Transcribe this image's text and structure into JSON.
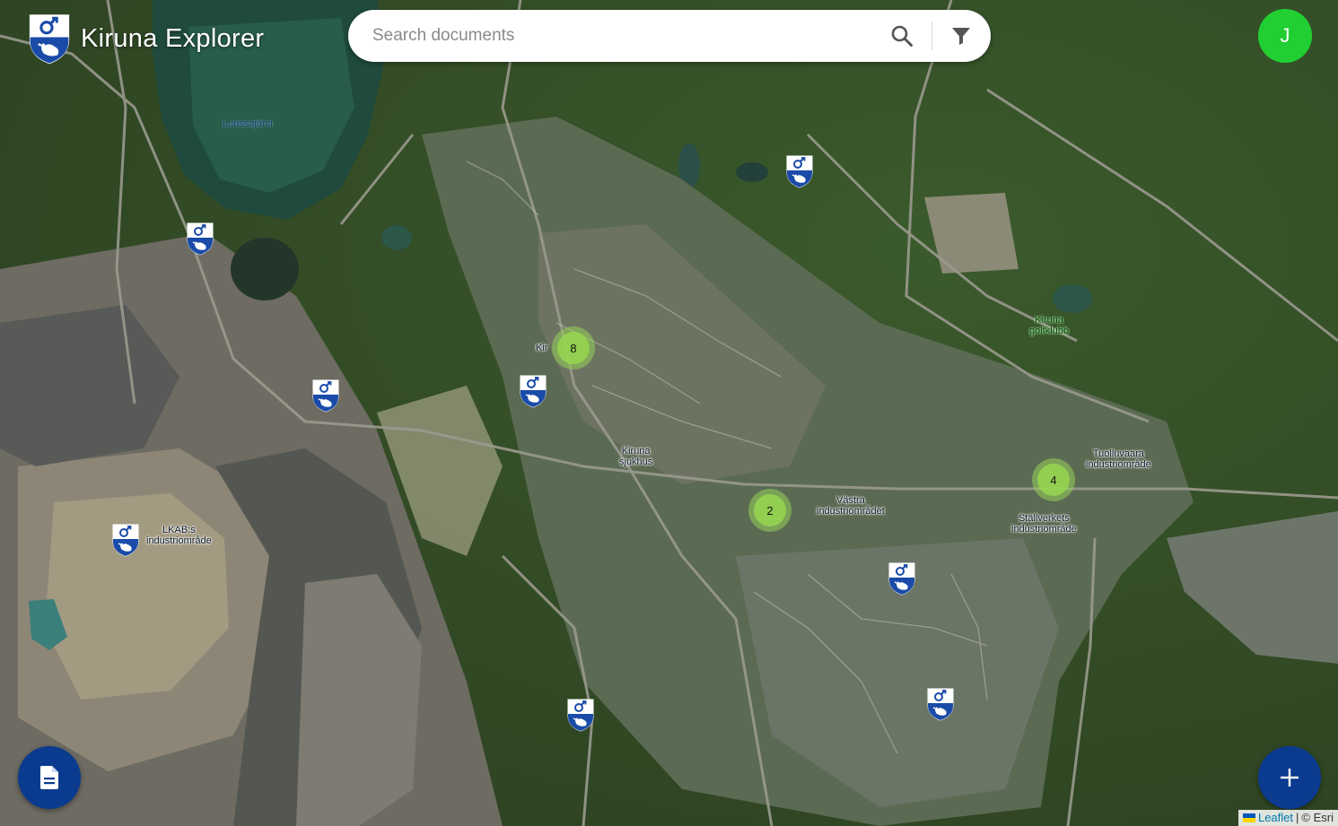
{
  "app": {
    "title": "Kiruna Explorer"
  },
  "search": {
    "placeholder": "Search documents"
  },
  "icons": {
    "logo": "kiruna-coat-of-arms-icon",
    "search": "search-icon",
    "filter": "filter-icon",
    "documents": "document-icon",
    "add": "plus-icon",
    "marker": "kiruna-coat-of-arms-icon"
  },
  "user": {
    "initial": "J"
  },
  "map_labels": [
    {
      "text": "Luossajärvi",
      "type": "water"
    },
    {
      "text": "Kiruna\ngolfklubb",
      "type": "green"
    },
    {
      "text": "Kiruna\nsjukhus",
      "type": "place"
    },
    {
      "text": "Västra\nindustriområdet",
      "type": "place"
    },
    {
      "text": "Tuolluvaara\nindustriområde",
      "type": "place"
    },
    {
      "text": "Ställverkets\nindustriområde",
      "type": "place"
    },
    {
      "text": "LKAB:s\nindustriområde",
      "type": "place"
    },
    {
      "text": "Kir",
      "type": "place"
    }
  ],
  "clusters": [
    {
      "count": "8"
    },
    {
      "count": "2"
    },
    {
      "count": "4"
    }
  ],
  "markers_count": 9,
  "attribution": {
    "leaflet": "Leaflet",
    "separator": "|",
    "copyright": "© Esri"
  },
  "colors": {
    "brand_blue": "#0a3b8f",
    "avatar_green": "#21cf32",
    "cluster_green": "#96d750"
  }
}
